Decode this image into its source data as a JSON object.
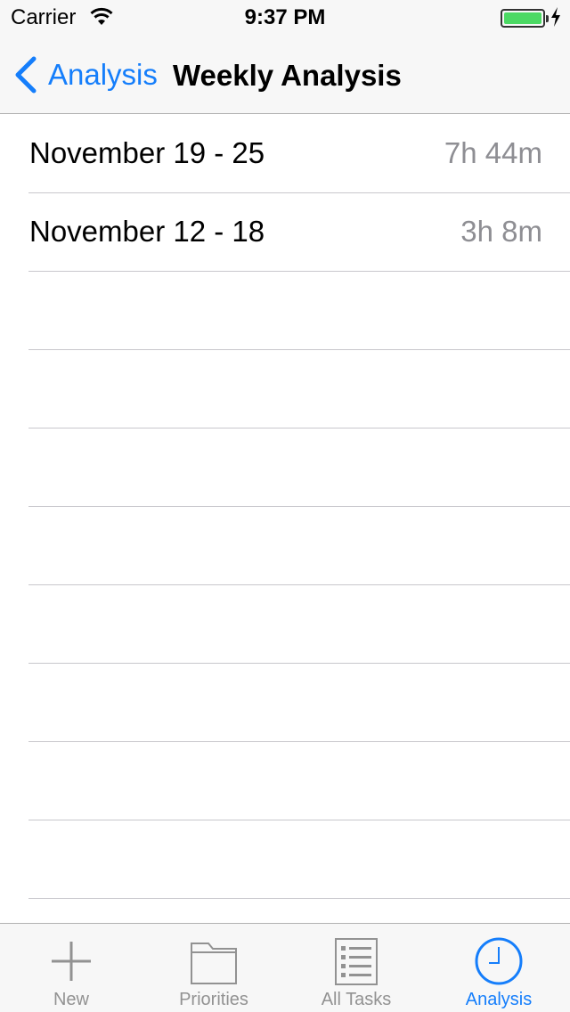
{
  "status_bar": {
    "carrier": "Carrier",
    "time": "9:37 PM"
  },
  "nav": {
    "back_label": "Analysis",
    "title": "Weekly Analysis"
  },
  "weeks": [
    {
      "range": "November 19 - 25",
      "total": "7h 44m"
    },
    {
      "range": "November 12 - 18",
      "total": "3h 8m"
    }
  ],
  "tabs": [
    {
      "label": "New",
      "icon": "plus-icon"
    },
    {
      "label": "Priorities",
      "icon": "folder-icon"
    },
    {
      "label": "All Tasks",
      "icon": "list-icon"
    },
    {
      "label": "Analysis",
      "icon": "clock-icon",
      "selected": true
    }
  ],
  "colors": {
    "accent": "#157efb",
    "tab_inactive": "#929292",
    "detail_text": "#8e8e93",
    "battery": "#4cd964"
  }
}
